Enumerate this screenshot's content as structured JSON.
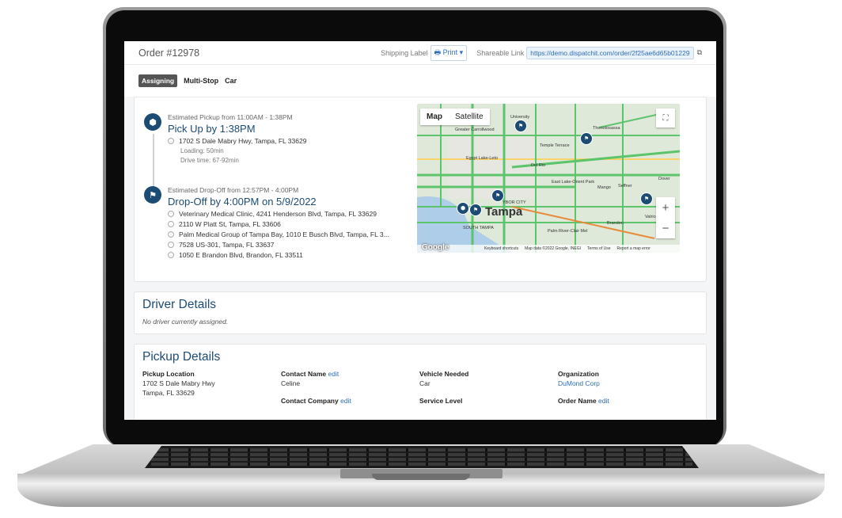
{
  "header": {
    "order": "Order #12978",
    "shipping_label": "Shipping Label",
    "print": "Print",
    "shareable_link_label": "Shareable Link",
    "shareable_link": "https://demo.dispatchit.com/order/2f25ae6d65b01229"
  },
  "tabs": {
    "status": "Assigning",
    "type": "Multi-Stop",
    "vehicle": "Car"
  },
  "pickup_stop": {
    "estimate": "Estimated Pickup from 11:00AM - 1:38PM",
    "title": "Pick Up by 1:38PM",
    "address": "1702 S Dale Mabry Hwy, Tampa, FL 33629",
    "loading": "Loading: 50min",
    "drive_time": "Drive time: 67-92min"
  },
  "dropoff_stop": {
    "estimate": "Estimated Drop-Off from 12:57PM - 4:00PM",
    "title": "Drop-Off by 4:00PM on 5/9/2022",
    "addresses": [
      "Veterinary Medical Clinic, 4241 Henderson Blvd, Tampa, FL 33629",
      "2110 W Platt St, Tampa, FL 33606",
      "Palm Medical Group of Tampa Bay, 1010 E Busch Blvd, Tampa, FL 3...",
      "7528 US-301, Tampa, FL 33637",
      "1050 E Brandon Blvd, Brandon, FL 33511"
    ]
  },
  "map": {
    "tab_map": "Map",
    "tab_satellite": "Satellite",
    "zoom_in": "+",
    "zoom_out": "−",
    "fullscreen": "⛶",
    "google": "Google",
    "attribution": [
      "Keyboard shortcuts",
      "Map data ©2022 Google, INEGI",
      "Terms of Use",
      "Report a map error"
    ],
    "city_main": "Tampa",
    "cities": [
      "Greater Carrollwood",
      "University",
      "Thonotosassa",
      "Temple Terrace",
      "Egypt Lake-Leto",
      "Del Rio",
      "East Lake-Orient Park",
      "Mango",
      "Seffner",
      "Dover",
      "Brandon",
      "Valrico",
      "Palm River-Clair Mel",
      "SOUTH TAMPA",
      "YBOR CITY"
    ]
  },
  "driver": {
    "title": "Driver Details",
    "status": "No driver currently assigned."
  },
  "pickup_details": {
    "title": "Pickup Details",
    "pickup_location_label": "Pickup Location",
    "pickup_location_line1": "1702 S Dale Mabry Hwy",
    "pickup_location_line2": "Tampa, FL 33629",
    "contact_name_label": "Contact Name",
    "edit": "edit",
    "contact_name": "Celine",
    "vehicle_label": "Vehicle Needed",
    "vehicle": "Car",
    "org_label": "Organization",
    "org": "DuMond Corp",
    "contact_company_label": "Contact Company",
    "service_level_label": "Service Level",
    "order_name_label": "Order Name"
  },
  "colors": {
    "accent": "#1c4b74",
    "link": "#2d6fb5"
  }
}
